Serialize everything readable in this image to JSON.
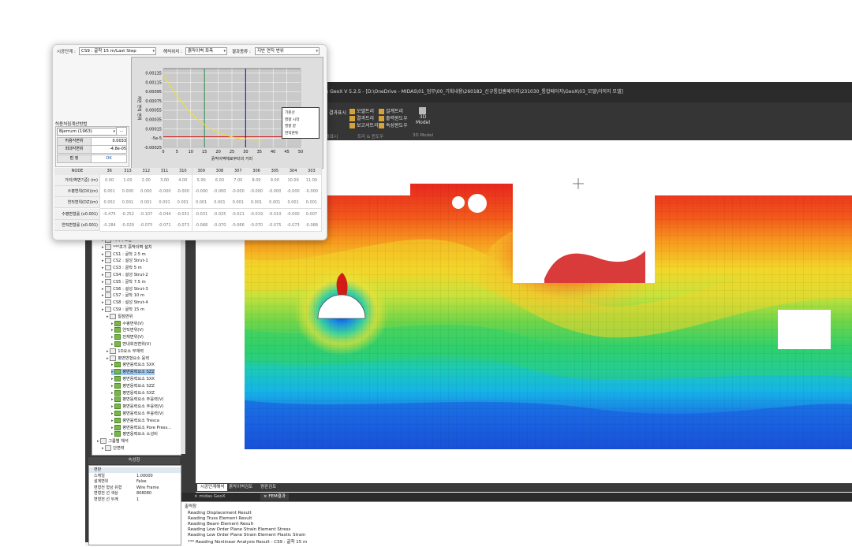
{
  "window": {
    "title": "midas GeoX V 5.2.5 - [D:\\OneDrive - MIDAS\\01_업무\\00_기획내용\\260182_신규통합홈페이지\\231030_통합페이지\\GeoX\\03_모델\\이미지 모델]"
  },
  "ribbon": {
    "items": [
      "결과표시",
      "모델트리",
      "결과트리",
      "보고서트리",
      "설계트리",
      "출력윈도우",
      "속성윈도우",
      "3D Model"
    ],
    "groups": [
      "결과표시",
      "트리 & 윈도우",
      "3D Model"
    ]
  },
  "dialog": {
    "stage_label": "시공단계 :",
    "stage_value": "CS9 : 굴착 15 m/Last Step",
    "pos_label": "해석위치 :",
    "pos_value": "흙막이벽 좌측",
    "result_label": "결과종류 :",
    "result_value": "지반 연직 변위",
    "method_group": "허용처짐계산방법",
    "method_value": "Bjerrum (1963)",
    "method_btn": "...",
    "allow_label": "허용각변위",
    "allow_value": "0.0033",
    "max_label": "최대각변위",
    "max_value": "-4.8e-05",
    "judge_label": "판 정",
    "judge_value": "OK"
  },
  "chart_data": {
    "type": "line",
    "xlabel": "흙막이벽체로부터의 거리",
    "ylabel": "지반 연직 변위",
    "xlim": [
      0,
      50
    ],
    "ylim": [
      -0.00025,
      0.00145
    ],
    "x_ticks": [
      "0",
      "5",
      "10",
      "15",
      "20",
      "25",
      "30",
      "35",
      "40",
      "45",
      "50"
    ],
    "y_ticks": [
      "0.00135",
      "0.00115",
      "0.00095",
      "0.00075",
      "0.00055",
      "0.00035",
      "0.00015",
      "-5e-5",
      "-0.00025"
    ],
    "legend": [
      "기준선",
      "영향 시작",
      "영향 끝",
      "연직변위"
    ],
    "colors": {
      "baseline": "#d11a1a",
      "influence_start": "#2f8a4d",
      "influence_end": "#1c2bd8",
      "curve": "#f0e12a"
    },
    "x": [
      0,
      2,
      4,
      6,
      8,
      10,
      12,
      14,
      16,
      18,
      20,
      22,
      24,
      26,
      28,
      30,
      32,
      34,
      36
    ],
    "series": [
      {
        "name": "연직변위",
        "values": [
          0.00132,
          0.00112,
          0.00094,
          0.00078,
          0.00063,
          0.0005,
          0.00038,
          0.00028,
          0.0002,
          0.00013,
          7e-05,
          3e-05,
          -1e-05,
          -4e-05,
          -6e-05,
          -7e-05,
          -8e-05,
          -9e-05,
          -9e-05
        ]
      }
    ],
    "baseline_y": -2e-05,
    "influence_start_x": 15,
    "influence_end_x": 30
  },
  "table": {
    "header": "NODE",
    "nodes": [
      "36",
      "313",
      "312",
      "311",
      "310",
      "309",
      "308",
      "307",
      "306",
      "305",
      "304",
      "303"
    ],
    "rows": [
      {
        "label": "거리(벽면기준) (m)",
        "values": [
          "0.00",
          "1.00",
          "2.00",
          "3.00",
          "4.00",
          "5.00",
          "6.00",
          "7.00",
          "8.00",
          "9.00",
          "10.00",
          "11.00"
        ]
      },
      {
        "label": "수평변위(DX)(m)",
        "values": [
          "0.001",
          "0.000",
          "0.000",
          "-0.000",
          "-0.000",
          "-0.000",
          "-0.000",
          "-0.000",
          "-0.000",
          "-0.000",
          "-0.000",
          "-0.000"
        ]
      },
      {
        "label": "연직변위(DZ)(m)",
        "values": [
          "0.002",
          "0.001",
          "0.001",
          "0.001",
          "0.001",
          "0.001",
          "0.001",
          "0.001",
          "0.001",
          "0.001",
          "0.001",
          "0.001"
        ]
      },
      {
        "label": "수평변형률 (x0.001)",
        "values": [
          "-0.475",
          "-0.252",
          "-0.107",
          "-0.044",
          "-0.031",
          "-0.031",
          "-0.025",
          "-0.021",
          "-0.019",
          "-0.010",
          "-0.000",
          "0.007"
        ]
      },
      {
        "label": "연직변형률 (x0.001)",
        "values": [
          "-0.284",
          "-0.029",
          "-0.075",
          "-0.071",
          "-0.073",
          "-0.068",
          "-0.070",
          "-0.066",
          "-0.070",
          "-0.075",
          "-0.073",
          "-0.068"
        ]
      }
    ]
  },
  "tree": {
    "items": [
      {
        "label": "지하구조물",
        "indent": 1
      },
      {
        "label": "***초기 흙막이벽 설치",
        "indent": 1
      },
      {
        "label": "CS1 : 굴착 2.5 m",
        "indent": 1
      },
      {
        "label": "CS2 : 설성 Strut-1",
        "indent": 1
      },
      {
        "label": "CS3 : 굴착 5 m",
        "indent": 1
      },
      {
        "label": "CS4 : 설성 Strut-2",
        "indent": 1
      },
      {
        "label": "CS5 : 굴착 7.5 m",
        "indent": 1
      },
      {
        "label": "CS6 : 설성 Strut-3",
        "indent": 1
      },
      {
        "label": "CS7 : 굴착 10 m",
        "indent": 1
      },
      {
        "label": "CS8 : 설성 Strut-4",
        "indent": 1
      },
      {
        "label": "CS9 : 굴착 15 m",
        "indent": 1
      },
      {
        "label": "절점변위",
        "indent": 2
      },
      {
        "label": "수평변위(V)",
        "indent": 3
      },
      {
        "label": "연직변위(V)",
        "indent": 3
      },
      {
        "label": "전체변위(V)",
        "indent": 3
      },
      {
        "label": "면내회전변위(V)",
        "indent": 3
      },
      {
        "label": "1D요소 부재력",
        "indent": 2
      },
      {
        "label": "평면변형요소 응력",
        "indent": 2
      },
      {
        "label": "평면응력요소 SXX",
        "indent": 3
      },
      {
        "label": "평면응력요소 SZZ",
        "indent": 3,
        "selected": true
      },
      {
        "label": "평면응력요소 SXX",
        "indent": 3
      },
      {
        "label": "평면응력요소 SZZ",
        "indent": 3
      },
      {
        "label": "평면응력요소 SXZ",
        "indent": 3
      },
      {
        "label": "평면응력요소 주응력(V)",
        "indent": 3
      },
      {
        "label": "평면응력요소 주응력(V)",
        "indent": 3
      },
      {
        "label": "평면응력요소 주응력(V)",
        "indent": 3
      },
      {
        "label": "평면응력요소 Tresca",
        "indent": 3
      },
      {
        "label": "평면응력요소 Pore Press...",
        "indent": 3
      },
      {
        "label": "평면응력요소 소성비",
        "indent": 3
      },
      {
        "label": "그룹별 해석",
        "indent": 0
      },
      {
        "label": "단면력",
        "indent": 1
      }
    ]
  },
  "properties": {
    "title": "속성창",
    "rows": [
      {
        "k": "면판",
        "v": ""
      },
      {
        "k": "스케일",
        "v": "1.00000"
      },
      {
        "k": "설계변위",
        "v": "False"
      },
      {
        "k": "변형전 형상 유형",
        "v": "Wire Frame"
      },
      {
        "k": "변형전 선 색상",
        "v": "808080"
      },
      {
        "k": "변형전 선 두께",
        "v": "1"
      }
    ]
  },
  "view_tabs": [
    "시공단계해석",
    "흙막이벽검토",
    "평판검토"
  ],
  "file_tabs": [
    "midas GeoX",
    "FEM결과"
  ],
  "output": {
    "title": "출력창",
    "lines": [
      "Reading Displacement Result",
      "Reading Truss Element Result",
      "Reading Beam Element Result",
      "Reading Low Order Plane Strain Element Stress",
      "Reading Low Order Plane Strain Element Plastic Strain",
      "*** Reading Nonlinear Analysis Result - CS9 : 굴착 15 m"
    ]
  }
}
